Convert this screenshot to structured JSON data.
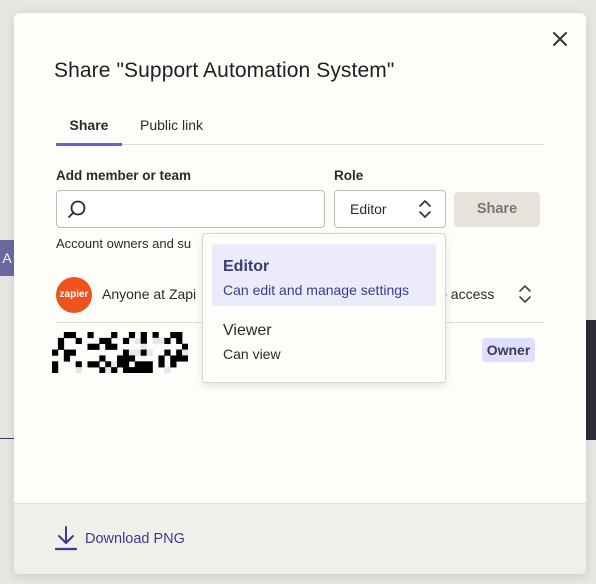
{
  "dialog": {
    "title": "Share \"Support Automation System\"",
    "tabs": [
      {
        "label": "Share",
        "active": true
      },
      {
        "label": "Public link",
        "active": false
      }
    ]
  },
  "form": {
    "member_label": "Add member or team",
    "member_value": "",
    "role_label": "Role",
    "role_value": "Editor",
    "share_button": "Share"
  },
  "helper_text": "Account owners and su",
  "access_rows": [
    {
      "avatar_text": "zapier",
      "name": "Anyone at Zapi",
      "access": "lo access"
    },
    {
      "badge": "Owner"
    }
  ],
  "role_dropdown": {
    "options": [
      {
        "label": "Editor",
        "description": "Can edit and manage settings",
        "selected": true
      },
      {
        "label": "Viewer",
        "description": "Can view",
        "selected": false
      }
    ]
  },
  "footer": {
    "download_label": "Download PNG"
  },
  "background": {
    "strip_letter": "A"
  },
  "icons": [
    "close-icon",
    "search-icon",
    "chevron-updown-icon",
    "download-icon"
  ],
  "colors": {
    "accent": "#6b5bd6",
    "link": "#3d3a8c",
    "zapier": "#f0521c",
    "badge_bg": "#e0deff",
    "selected_bg": "#ecebfa"
  }
}
